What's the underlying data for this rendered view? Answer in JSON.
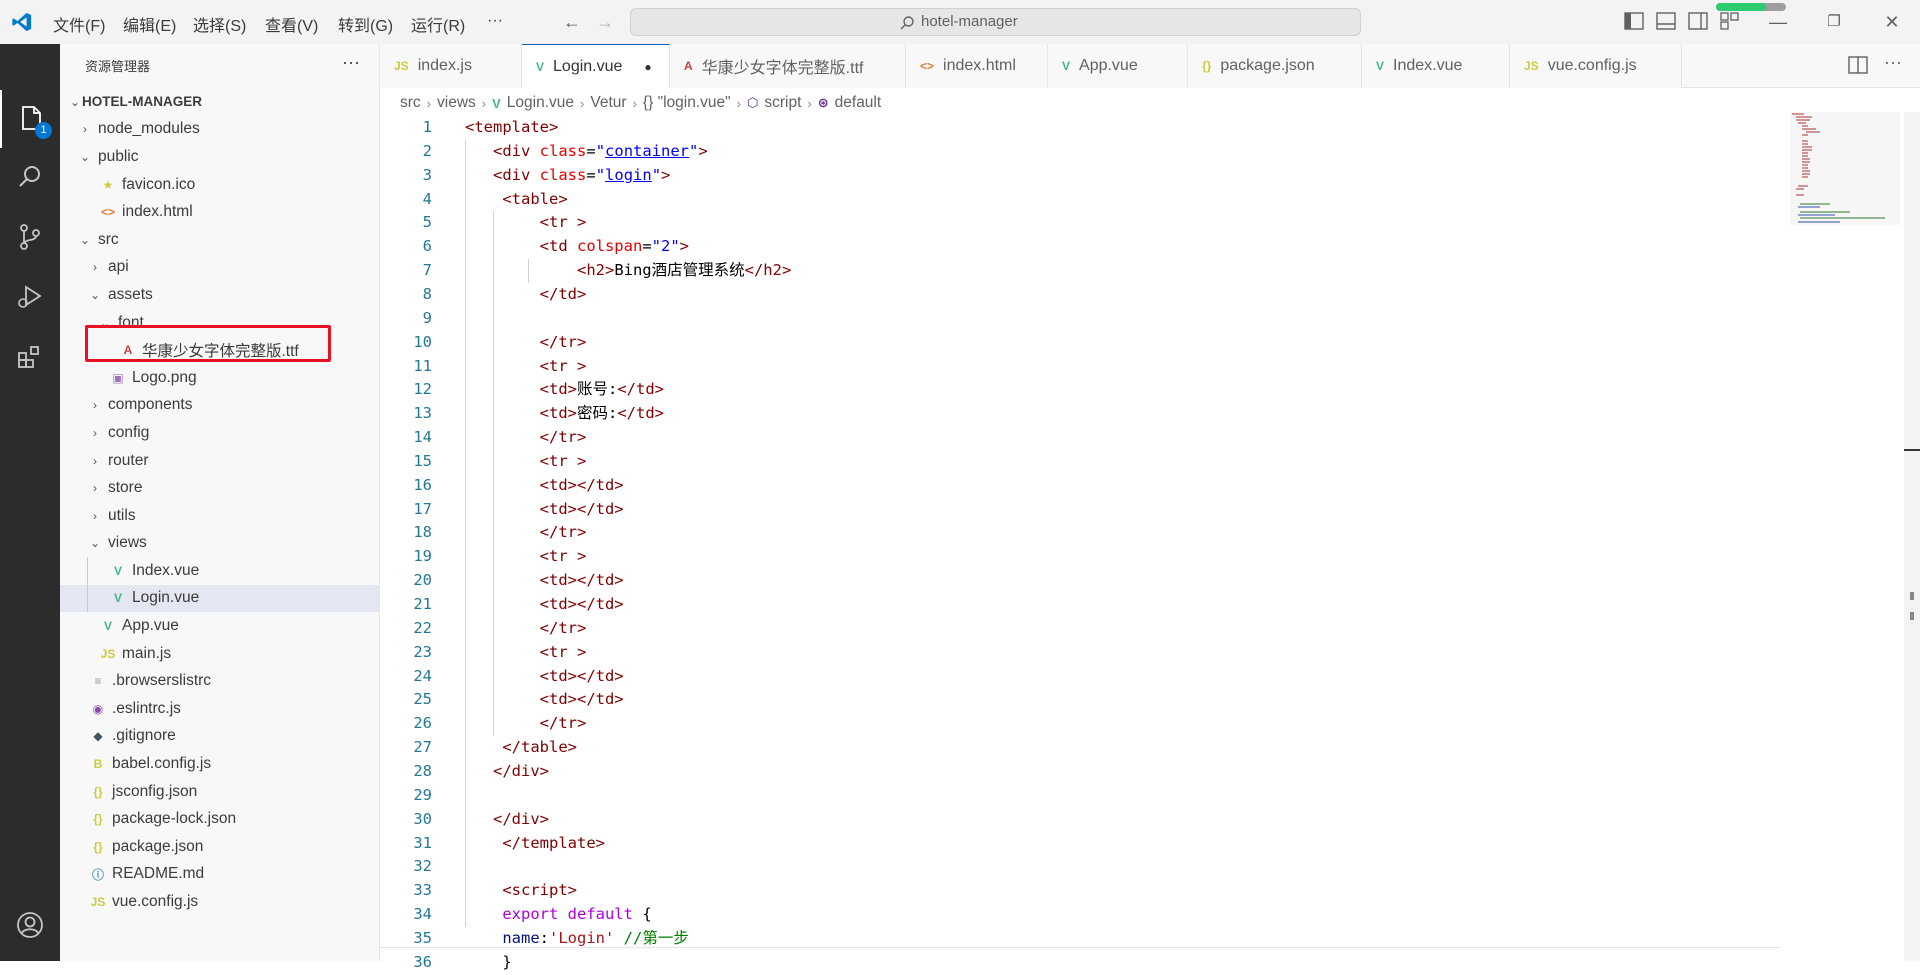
{
  "titlebar": {
    "menus": [
      "文件(F)",
      "编辑(E)",
      "选择(S)",
      "查看(V)",
      "转到(G)",
      "运行(R)",
      "···"
    ],
    "search_text": "hotel-manager"
  },
  "sidebar": {
    "title": "资源管理器",
    "more": "···",
    "root": "HOTEL-MANAGER",
    "items": [
      {
        "label": "node_modules",
        "type": "folder",
        "open": false,
        "depth": 1
      },
      {
        "label": "public",
        "type": "folder",
        "open": true,
        "depth": 1
      },
      {
        "label": "favicon.ico",
        "type": "star",
        "depth": 2
      },
      {
        "label": "index.html",
        "type": "html",
        "depth": 2
      },
      {
        "label": "src",
        "type": "folder",
        "open": true,
        "depth": 1
      },
      {
        "label": "api",
        "type": "folder",
        "open": false,
        "depth": 2
      },
      {
        "label": "assets",
        "type": "folder",
        "open": true,
        "depth": 2
      },
      {
        "label": "font",
        "type": "folder",
        "open": true,
        "depth": 3
      },
      {
        "label": "华康少女字体完整版.ttf",
        "type": "font",
        "depth": 4
      },
      {
        "label": "Logo.png",
        "type": "image",
        "depth": 3
      },
      {
        "label": "components",
        "type": "folder",
        "open": false,
        "depth": 2
      },
      {
        "label": "config",
        "type": "folder",
        "open": false,
        "depth": 2
      },
      {
        "label": "router",
        "type": "folder",
        "open": false,
        "depth": 2
      },
      {
        "label": "store",
        "type": "folder",
        "open": false,
        "depth": 2
      },
      {
        "label": "utils",
        "type": "folder",
        "open": false,
        "depth": 2
      },
      {
        "label": "views",
        "type": "folder",
        "open": true,
        "depth": 2
      },
      {
        "label": "Index.vue",
        "type": "vue",
        "depth": 3
      },
      {
        "label": "Login.vue",
        "type": "vue",
        "depth": 3,
        "selected": true
      },
      {
        "label": "App.vue",
        "type": "vue",
        "depth": 2
      },
      {
        "label": "main.js",
        "type": "js",
        "depth": 2
      },
      {
        "label": ".browserslistrc",
        "type": "lines",
        "depth": 1
      },
      {
        "label": ".eslintrc.js",
        "type": "eslint",
        "depth": 1
      },
      {
        "label": ".gitignore",
        "type": "git",
        "depth": 1
      },
      {
        "label": "babel.config.js",
        "type": "babel",
        "depth": 1
      },
      {
        "label": "jsconfig.json",
        "type": "json",
        "depth": 1
      },
      {
        "label": "package-lock.json",
        "type": "json",
        "depth": 1
      },
      {
        "label": "package.json",
        "type": "json",
        "depth": 1
      },
      {
        "label": "README.md",
        "type": "info",
        "depth": 1
      },
      {
        "label": "vue.config.js",
        "type": "js",
        "depth": 1
      }
    ]
  },
  "activity": {
    "badge": "1"
  },
  "tabs": [
    {
      "label": "index.js",
      "type": "js"
    },
    {
      "label": "Login.vue",
      "type": "vue",
      "active": true,
      "dirty": "●"
    },
    {
      "label": "华康少女字体完整版.ttf",
      "type": "font"
    },
    {
      "label": "index.html",
      "type": "html"
    },
    {
      "label": "App.vue",
      "type": "vue"
    },
    {
      "label": "package.json",
      "type": "json"
    },
    {
      "label": "Index.vue",
      "type": "vue"
    },
    {
      "label": "vue.config.js",
      "type": "js"
    }
  ],
  "breadcrumb": [
    "src",
    "views",
    "Login.vue",
    "Vetur",
    "{} \"login.vue\"",
    "script",
    "default"
  ],
  "code_lines": [
    [
      [
        "tag",
        "<template>"
      ]
    ],
    [
      [
        "sp",
        "   "
      ],
      [
        "tag",
        "<div "
      ],
      [
        "attr",
        "class"
      ],
      [
        "punct",
        "="
      ],
      [
        "strplain",
        "\""
      ],
      [
        "str",
        "container"
      ],
      [
        "strplain",
        "\""
      ],
      [
        "tag",
        ">"
      ]
    ],
    [
      [
        "sp",
        "   "
      ],
      [
        "tag",
        "<div "
      ],
      [
        "attr",
        "class"
      ],
      [
        "punct",
        "="
      ],
      [
        "strplain",
        "\""
      ],
      [
        "str",
        "login"
      ],
      [
        "strplain",
        "\""
      ],
      [
        "tag",
        ">"
      ]
    ],
    [
      [
        "sp",
        "    "
      ],
      [
        "tag",
        "<table>"
      ]
    ],
    [
      [
        "sp",
        "        "
      ],
      [
        "tag",
        "<tr >"
      ]
    ],
    [
      [
        "sp",
        "        "
      ],
      [
        "tag",
        "<td "
      ],
      [
        "attr",
        "colspan"
      ],
      [
        "punct",
        "="
      ],
      [
        "strplain",
        "\"2\""
      ],
      [
        "tag",
        ">"
      ]
    ],
    [
      [
        "sp",
        "            "
      ],
      [
        "tag",
        "<h2>"
      ],
      [
        "txt",
        "Bing酒店管理系统"
      ],
      [
        "tag",
        "</h2>"
      ]
    ],
    [
      [
        "sp",
        "        "
      ],
      [
        "tag",
        "</td>"
      ]
    ],
    [
      [
        "sp",
        ""
      ]
    ],
    [
      [
        "sp",
        "        "
      ],
      [
        "tag",
        "</tr>"
      ]
    ],
    [
      [
        "sp",
        "        "
      ],
      [
        "tag",
        "<tr >"
      ]
    ],
    [
      [
        "sp",
        "        "
      ],
      [
        "tag",
        "<td>"
      ],
      [
        "txt",
        "账号:"
      ],
      [
        "tag",
        "</td>"
      ]
    ],
    [
      [
        "sp",
        "        "
      ],
      [
        "tag",
        "<td>"
      ],
      [
        "txt",
        "密码:"
      ],
      [
        "tag",
        "</td>"
      ]
    ],
    [
      [
        "sp",
        "        "
      ],
      [
        "tag",
        "</tr>"
      ]
    ],
    [
      [
        "sp",
        "        "
      ],
      [
        "tag",
        "<tr >"
      ]
    ],
    [
      [
        "sp",
        "        "
      ],
      [
        "tag",
        "<td></td>"
      ]
    ],
    [
      [
        "sp",
        "        "
      ],
      [
        "tag",
        "<td></td>"
      ]
    ],
    [
      [
        "sp",
        "        "
      ],
      [
        "tag",
        "</tr>"
      ]
    ],
    [
      [
        "sp",
        "        "
      ],
      [
        "tag",
        "<tr >"
      ]
    ],
    [
      [
        "sp",
        "        "
      ],
      [
        "tag",
        "<td></td>"
      ]
    ],
    [
      [
        "sp",
        "        "
      ],
      [
        "tag",
        "<td></td>"
      ]
    ],
    [
      [
        "sp",
        "        "
      ],
      [
        "tag",
        "</tr>"
      ]
    ],
    [
      [
        "sp",
        "        "
      ],
      [
        "tag",
        "<tr >"
      ]
    ],
    [
      [
        "sp",
        "        "
      ],
      [
        "tag",
        "<td></td>"
      ]
    ],
    [
      [
        "sp",
        "        "
      ],
      [
        "tag",
        "<td></td>"
      ]
    ],
    [
      [
        "sp",
        "        "
      ],
      [
        "tag",
        "</tr>"
      ]
    ],
    [
      [
        "sp",
        "    "
      ],
      [
        "tag",
        "</table>"
      ]
    ],
    [
      [
        "sp",
        "   "
      ],
      [
        "tag",
        "</div>"
      ]
    ],
    [
      [
        "sp",
        ""
      ]
    ],
    [
      [
        "sp",
        "   "
      ],
      [
        "tag",
        "</div>"
      ]
    ],
    [
      [
        "sp",
        "    "
      ],
      [
        "tag",
        "</template>"
      ]
    ],
    [
      [
        "sp",
        ""
      ]
    ],
    [
      [
        "sp",
        "    "
      ],
      [
        "tag",
        "<script>"
      ]
    ],
    [
      [
        "sp",
        "    "
      ],
      [
        "kw",
        "export default "
      ],
      [
        "punct",
        "{"
      ]
    ],
    [
      [
        "sp",
        "    "
      ],
      [
        "prop",
        "name"
      ],
      [
        "punct",
        ":"
      ],
      [
        "str2",
        "'Login'"
      ],
      [
        "punct",
        " "
      ],
      [
        "cmt",
        "//第一步"
      ]
    ],
    [
      [
        "sp",
        "    "
      ],
      [
        "punct",
        "}"
      ]
    ]
  ],
  "colors": {
    "activity_bg": "#2c2c2c",
    "accent": "#0078d4",
    "highlight_box": "#e81123",
    "vue_green": "#41b883",
    "js_yellow": "#cbcb41"
  }
}
